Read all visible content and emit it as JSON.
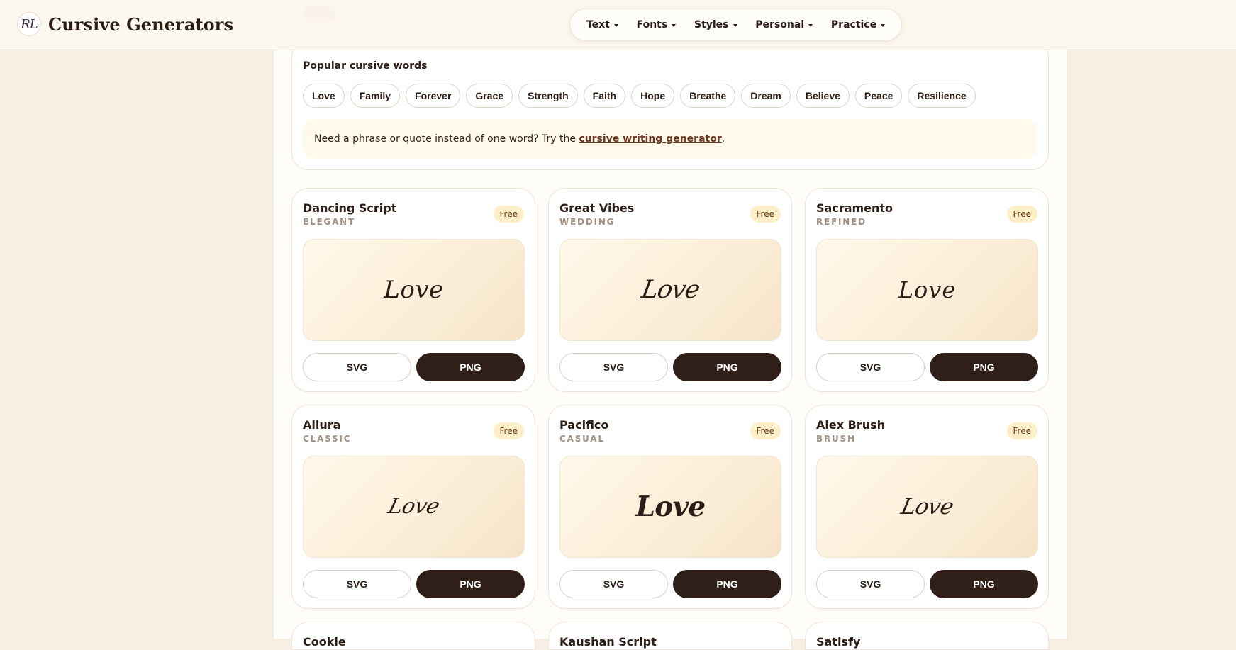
{
  "header": {
    "brand_mark": "RL",
    "brand_title": "Cursive Generators",
    "nav": [
      {
        "label": "Text"
      },
      {
        "label": "Fonts"
      },
      {
        "label": "Styles"
      },
      {
        "label": "Personal"
      },
      {
        "label": "Practice"
      }
    ]
  },
  "popular": {
    "title": "Popular cursive words",
    "tags": [
      "Love",
      "Family",
      "Forever",
      "Grace",
      "Strength",
      "Faith",
      "Hope",
      "Breathe",
      "Dream",
      "Believe",
      "Peace",
      "Resilience"
    ],
    "hint_prefix": "Need a phrase or quote instead of one word? Try the ",
    "hint_link": "cursive writing generator",
    "hint_suffix": "."
  },
  "cards": [
    {
      "name": "Dancing Script",
      "category": "ELEGANT",
      "badge": "Free",
      "preview": "Love",
      "svg_label": "SVG",
      "png_label": "PNG"
    },
    {
      "name": "Great Vibes",
      "category": "WEDDING",
      "badge": "Free",
      "preview": "Love",
      "svg_label": "SVG",
      "png_label": "PNG"
    },
    {
      "name": "Sacramento",
      "category": "REFINED",
      "badge": "Free",
      "preview": "Love",
      "svg_label": "SVG",
      "png_label": "PNG"
    },
    {
      "name": "Allura",
      "category": "CLASSIC",
      "badge": "Free",
      "preview": "Love",
      "svg_label": "SVG",
      "png_label": "PNG"
    },
    {
      "name": "Pacifico",
      "category": "CASUAL",
      "badge": "Free",
      "preview": "Love",
      "svg_label": "SVG",
      "png_label": "PNG"
    },
    {
      "name": "Alex Brush",
      "category": "BRUSH",
      "badge": "Free",
      "preview": "Love",
      "svg_label": "SVG",
      "png_label": "PNG"
    }
  ],
  "partial_cards": [
    {
      "name": "Cookie"
    },
    {
      "name": "Kaushan Script"
    },
    {
      "name": "Satisfy"
    }
  ]
}
